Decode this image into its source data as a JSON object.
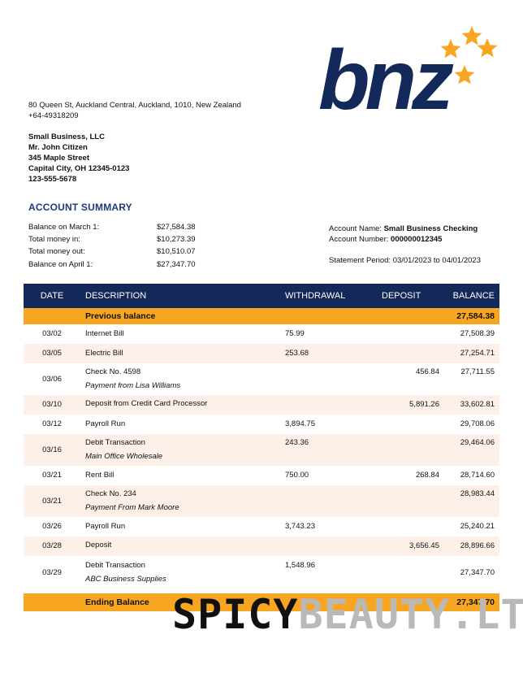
{
  "logo": {
    "text": "bnz",
    "color": "#13295a",
    "star_color": "#f7a621"
  },
  "bank": {
    "address": "80 Queen St, Auckland Central, Auckland, 1010, New Zealand",
    "phone": "+64-49318209"
  },
  "customer": {
    "lines": [
      "Small Business, LLC",
      "Mr. John Citizen",
      "345 Maple Street",
      "Capital City, OH 12345-0123",
      "123-555-5678"
    ]
  },
  "summary": {
    "title": "ACCOUNT SUMMARY",
    "rows": [
      {
        "label": "Balance on March 1:",
        "value": "$27,584.38"
      },
      {
        "label": "Total money in:",
        "value": "$10,273.39"
      },
      {
        "label": "Total money out:",
        "value": "$10,510.07"
      },
      {
        "label": "Balance on April 1:",
        "value": "$27,347.70"
      }
    ]
  },
  "account": {
    "name_label": "Account Name:",
    "name": "Small Business Checking",
    "number_label": "Account Number:",
    "number": "000000012345",
    "period_label": "Statement Period:",
    "period": "03/01/2023 to 04/01/2023"
  },
  "table": {
    "headers": {
      "date": "DATE",
      "description": "DESCRIPTION",
      "withdrawal": "WITHDRAWAL",
      "deposit": "DEPOSIT",
      "balance": "BALANCE"
    },
    "previous": {
      "label": "Previous balance",
      "balance": "27,584.38"
    },
    "rows": [
      {
        "date": "03/02",
        "desc": "Internet Bill",
        "sub": "",
        "withdrawal": "75.99",
        "deposit": "",
        "balance": "27,508.39"
      },
      {
        "date": "03/05",
        "desc": "Electric Bill",
        "sub": "",
        "withdrawal": "253.68",
        "deposit": "",
        "balance": "27,254.71"
      },
      {
        "date": "03/06",
        "desc": "Check No. 4598",
        "sub": "Payment from Lisa Williams",
        "withdrawal": "",
        "deposit": "456.84",
        "balance": "27,711.55"
      },
      {
        "date": "03/10",
        "desc": "Deposit from Credit Card Processor",
        "sub": "",
        "withdrawal": "",
        "deposit": "5,891.26",
        "balance": "33,602.81"
      },
      {
        "date": "03/12",
        "desc": "Payroll Run",
        "sub": "",
        "withdrawal": "3,894.75",
        "deposit": "",
        "balance": "29,708.06"
      },
      {
        "date": "03/16",
        "desc": "Debit Transaction",
        "sub": "Main Office Wholesale",
        "withdrawal": "243.36",
        "deposit": "",
        "balance": "29,464.06"
      },
      {
        "date": "03/21",
        "desc": "Rent Bill",
        "sub": "",
        "withdrawal": "750.00",
        "deposit": "268.84",
        "balance": "28,714.60"
      },
      {
        "date": "03/21",
        "desc": "Check No. 234",
        "sub": "Payment From Mark Moore",
        "withdrawal": "",
        "deposit": "",
        "balance": "28,983.44"
      },
      {
        "date": "03/26",
        "desc": "Payroll Run",
        "sub": "",
        "withdrawal": "3,743.23",
        "deposit": "",
        "balance": "25,240.21"
      },
      {
        "date": "03/28",
        "desc": "Deposit",
        "sub": "",
        "withdrawal": "",
        "deposit": "3,656.45",
        "balance": "28,896.66"
      },
      {
        "date": "03/29",
        "desc": "Debit Transaction",
        "sub": "ABC Business Supplies",
        "withdrawal": "1,548.96",
        "deposit": "",
        "balance": "27,347.70"
      }
    ],
    "ending": {
      "label": "Ending Balance",
      "balance": "27,347.70"
    }
  },
  "watermark": {
    "part1": "SPICY",
    "part2": "BEAUTY.LT"
  }
}
